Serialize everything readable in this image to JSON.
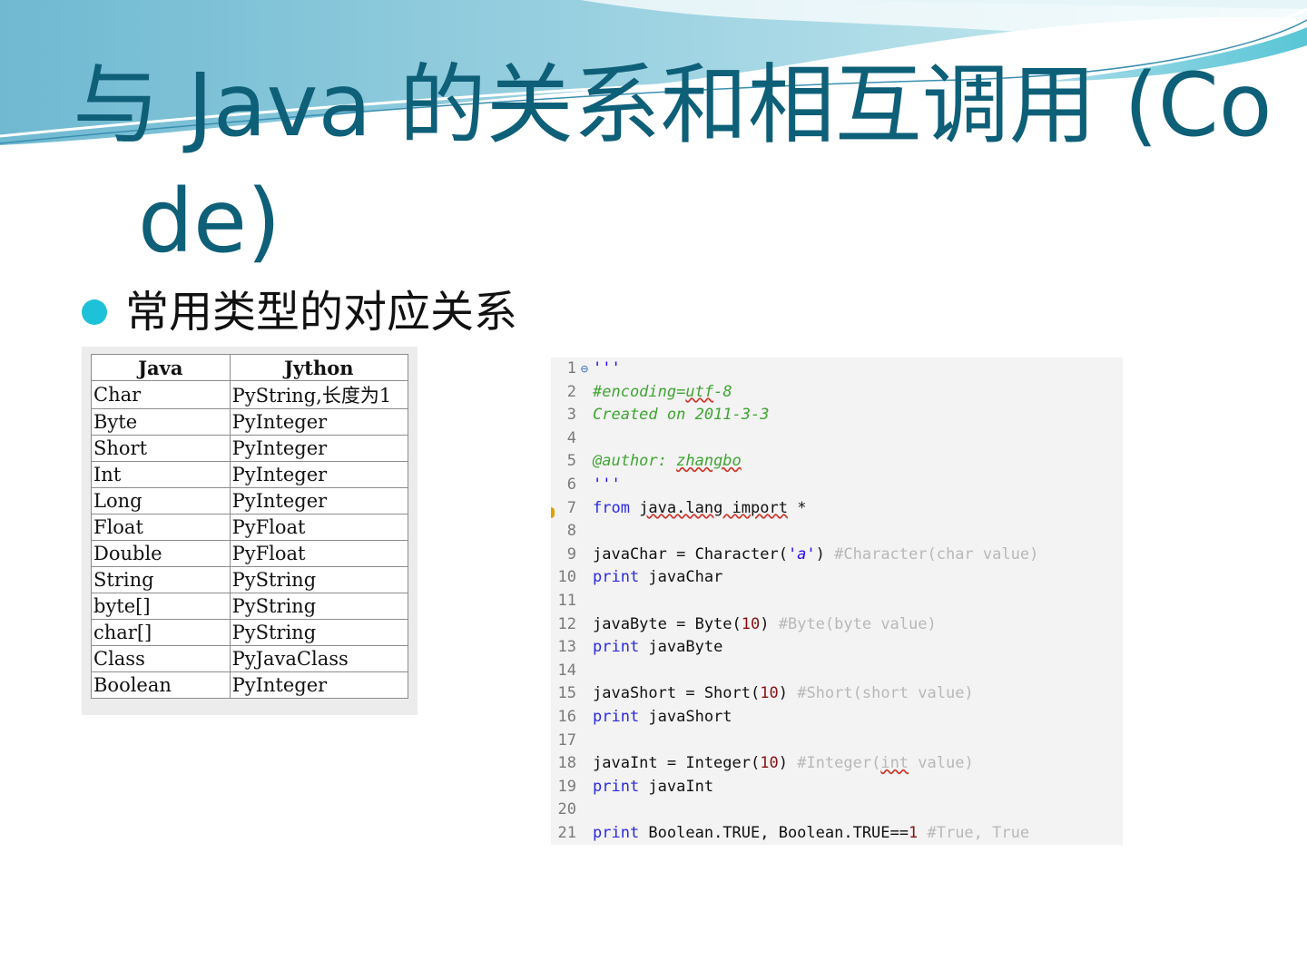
{
  "slide": {
    "title_line1": "与 Java 的关系和相互调用 (Co",
    "title_line2": "de)",
    "bullet": "常用类型的对应关系"
  },
  "type_table": {
    "headers": [
      "Java",
      "Jython"
    ],
    "rows": [
      [
        "Char",
        "PyString,长度为1"
      ],
      [
        "Byte",
        "PyInteger"
      ],
      [
        "Short",
        "PyInteger"
      ],
      [
        "Int",
        "PyInteger"
      ],
      [
        "Long",
        "PyInteger"
      ],
      [
        "Float",
        "PyFloat"
      ],
      [
        "Double",
        "PyFloat"
      ],
      [
        "String",
        "PyString"
      ],
      [
        "byte[]",
        "PyString"
      ],
      [
        "char[]",
        "PyString"
      ],
      [
        "Class",
        "PyJavaClass"
      ],
      [
        "Boolean",
        "PyInteger"
      ]
    ]
  },
  "code_editor": {
    "line_numbers": [
      "1",
      "2",
      "3",
      "4",
      "5",
      "6",
      "7",
      "8",
      "9",
      "10",
      "11",
      "12",
      "13",
      "14",
      "15",
      "16",
      "17",
      "18",
      "19",
      "20",
      "21"
    ],
    "lines": {
      "l1": "'''",
      "l2a": "#encoding=",
      "l2b": "utf",
      "l2c": "-8",
      "l3": "Created on 2011-3-3",
      "l5a": "@author: ",
      "l5b": "zhangbo",
      "l6": "'''",
      "l7a": "from ",
      "l7b": "java.lang import",
      "l7c": " *",
      "l9a": "javaChar = Character(",
      "l9b": "'a'",
      "l9c": ") ",
      "l9d": "#Character(char value)",
      "l10a": "print",
      "l10b": " javaChar",
      "l12a": "javaByte = Byte(",
      "l12b": "10",
      "l12c": ") ",
      "l12d": "#Byte(byte value)",
      "l13a": "print",
      "l13b": " javaByte",
      "l15a": "javaShort = Short(",
      "l15b": "10",
      "l15c": ") ",
      "l15d": "#Short(short value)",
      "l16a": "print",
      "l16b": " javaShort",
      "l18a": "javaInt = Integer(",
      "l18b": "10",
      "l18c": ") ",
      "l18d": "#Integer(",
      "l18e": "int",
      "l18f": " value)",
      "l19a": "print",
      "l19b": " javaInt",
      "l21a": "print",
      "l21b": " Boolean.TRUE, Boolean.TRUE==",
      "l21c": "1",
      "l21d": " #True, True"
    }
  }
}
